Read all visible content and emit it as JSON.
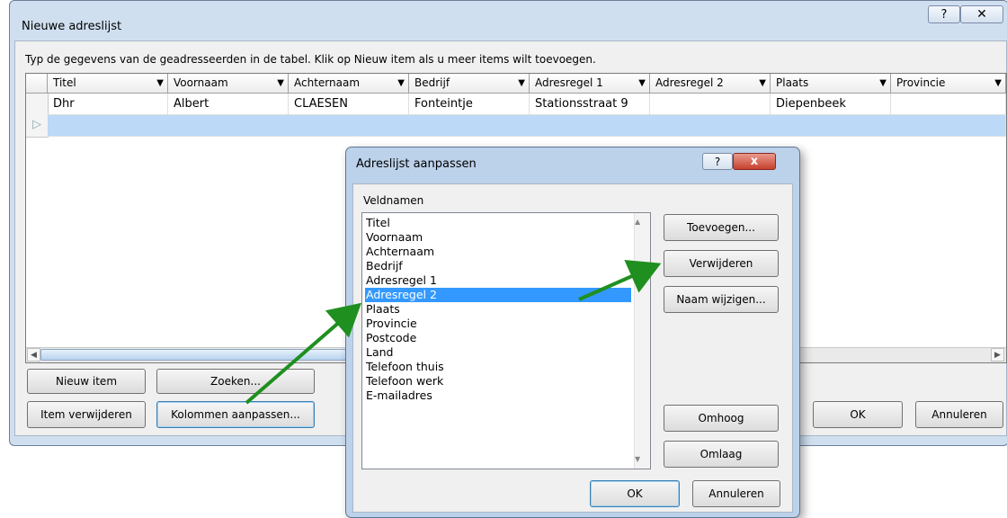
{
  "window": {
    "title": "Nieuwe adreslijst",
    "help": "?",
    "close": "✕",
    "instruction": "Typ de gegevens van de geadresseerden in de tabel. Klik op Nieuw item als u meer items wilt toevoegen."
  },
  "grid": {
    "columns": [
      "Titel",
      "Voornaam",
      "Achternaam",
      "Bedrijf",
      "Adresregel 1",
      "Adresregel 2",
      "Plaats",
      "Provincie"
    ],
    "rows": [
      [
        "Dhr",
        "Albert",
        "CLAESEN",
        "Fonteintje",
        "Stationsstraat 9",
        "",
        "Diepenbeek",
        ""
      ]
    ],
    "new_row_marker": "▷"
  },
  "buttons": {
    "new_item": "Nieuw item",
    "search": "Zoeken...",
    "remove_item": "Item verwijderen",
    "customize_columns": "Kolommen aanpassen...",
    "ok": "OK",
    "cancel": "Annuleren"
  },
  "dialog": {
    "title": "Adreslijst aanpassen",
    "help": "?",
    "close": "x",
    "fields_label": "Veldnamen",
    "fields": [
      "Titel",
      "Voornaam",
      "Achternaam",
      "Bedrijf",
      "Adresregel 1",
      "Adresregel 2",
      "Plaats",
      "Provincie",
      "Postcode",
      "Land",
      "Telefoon thuis",
      "Telefoon werk",
      "E-mailadres"
    ],
    "selected_field": "Adresregel 2",
    "buttons": {
      "add": "Toevoegen...",
      "remove": "Verwijderen",
      "rename": "Naam wijzigen...",
      "up": "Omhoog",
      "down": "Omlaag",
      "ok": "OK",
      "cancel": "Annuleren"
    }
  },
  "colors": {
    "selection": "#3399ff",
    "new_row": "#bcd9f7",
    "annotation_arrow": "#1f8f1f"
  }
}
